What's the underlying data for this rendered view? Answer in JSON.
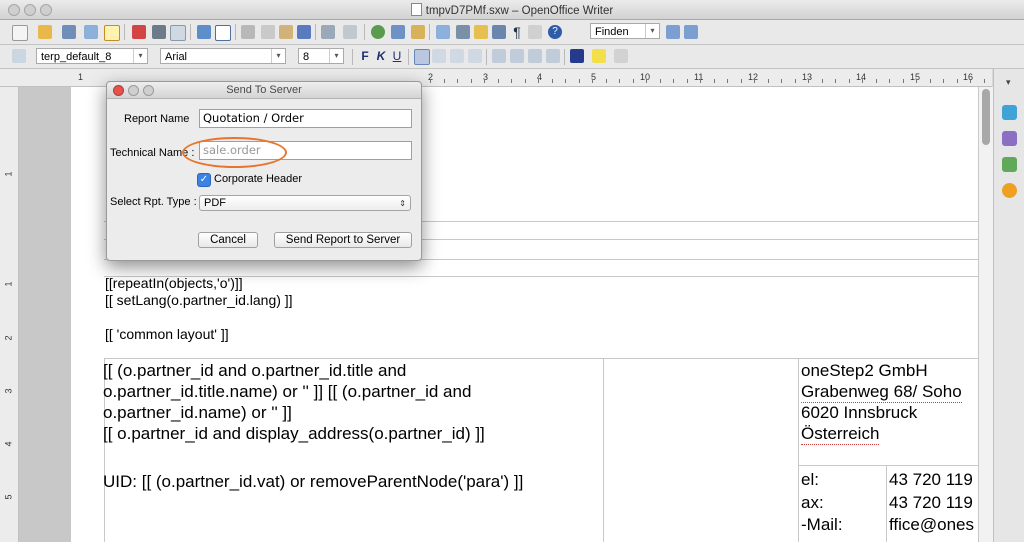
{
  "window": {
    "title": "tmpvD7PMf.sxw – OpenOffice Writer"
  },
  "toolbar": {
    "find_value": "Finden",
    "paragraph_style": "terp_default_8",
    "font_name": "Arial",
    "font_size": "8",
    "bold_label": "F",
    "italic_label": "K",
    "underline_label": "U"
  },
  "ruler": {
    "numbers": [
      "1",
      "1",
      "2",
      "3",
      "4",
      "5",
      "6",
      "7",
      "8",
      "9",
      "10",
      "11",
      "12",
      "13",
      "14",
      "15",
      "16"
    ]
  },
  "vruler": {
    "numbers": [
      "1",
      "1",
      "2",
      "3",
      "4",
      "5"
    ]
  },
  "document": {
    "line1": "[[repeatIn(objects,'o')]]",
    "line2": "[[ setLang(o.partner_id.lang) ]]",
    "line3": "[[ 'common layout' ]]",
    "addr1": "[[ (o.partner_id and o.partner_id.title and",
    "addr2": "o.partner_id.title.name) or '' ]] [[ (o.partner_id and",
    "addr3": "o.partner_id.name) or '' ]]",
    "addr4": "[[ o.partner_id and display_address(o.partner_id) ]]",
    "uid": "UID: [[ (o.partner_id.vat) or removeParentNode('para') ]]",
    "company1": "oneStep2 GmbH",
    "company2": "Grabenweg 68/ Soho",
    "company3": "6020 Innsbruck",
    "company4": "Österreich",
    "tel_label": "el:",
    "tel_value": "43 720 119",
    "fax_label": "ax:",
    "fax_value": "43 720 119",
    "mail_label": "-Mail:",
    "mail_value": "ffice@ones"
  },
  "dialog": {
    "title": "Send To Server",
    "report_name_label": "Report Name",
    "report_name_value": "Quotation / Order",
    "technical_name_label": "Technical Name :",
    "technical_name_placeholder": "sale.order",
    "corporate_header_label": "Corporate Header",
    "corporate_header_checked": true,
    "report_type_label": "Select Rpt. Type :",
    "report_type_value": "PDF",
    "cancel_label": "Cancel",
    "send_label": "Send Report to Server"
  },
  "colors": {
    "highlight_oval": "#e8742c",
    "checkbox": "#3a82e6"
  }
}
